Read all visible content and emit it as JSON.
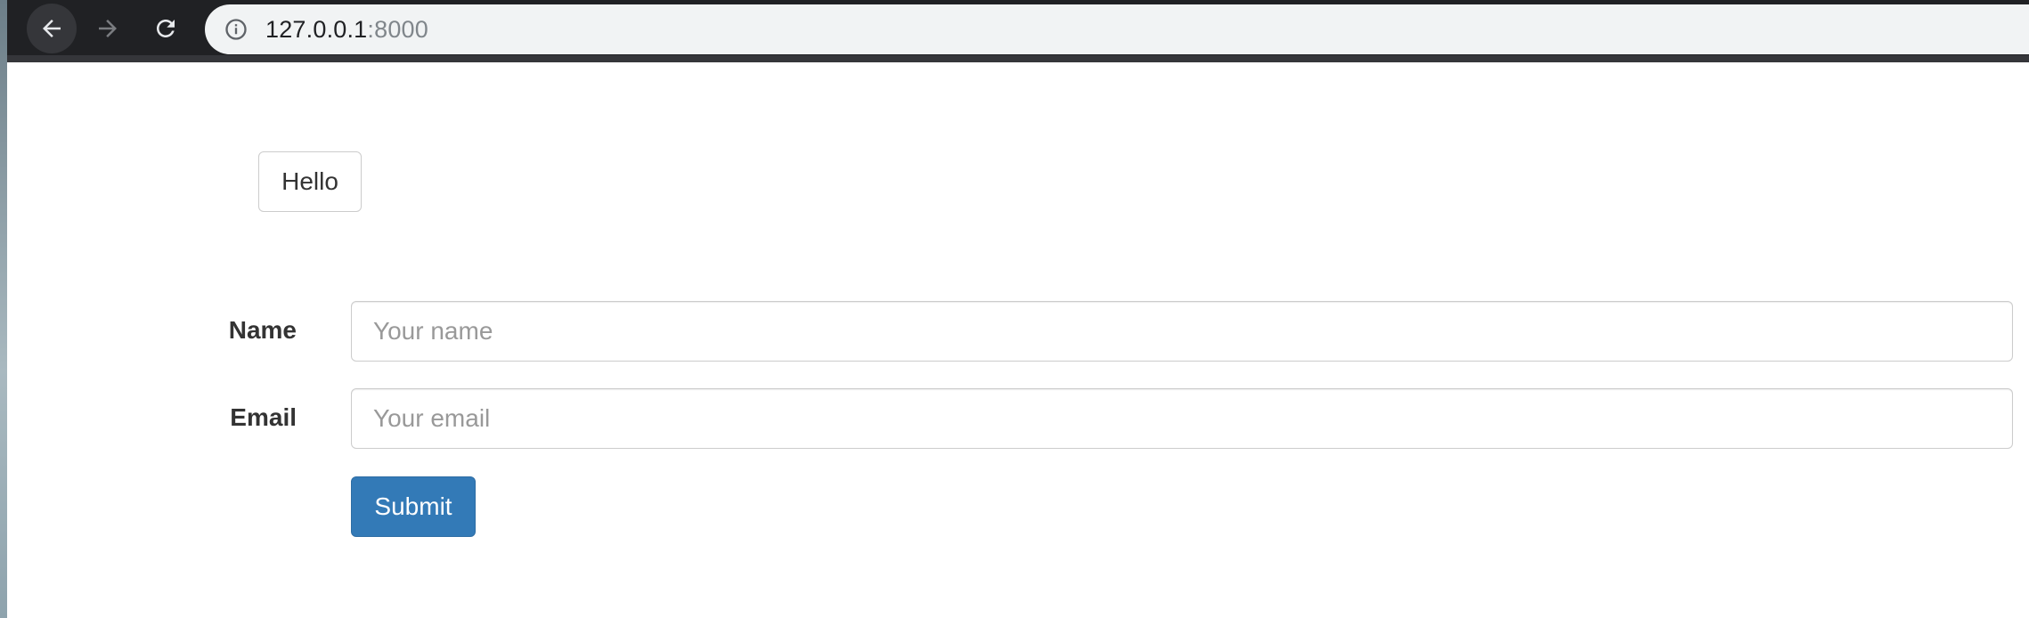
{
  "browser": {
    "url_host": "127.0.0.1",
    "url_port": ":8000",
    "icons": {
      "back": "arrow-left-icon",
      "forward": "arrow-right-icon",
      "reload": "reload-icon",
      "site_info": "info-icon"
    }
  },
  "page": {
    "hello_button_label": "Hello",
    "form": {
      "name_label": "Name",
      "name_placeholder": "Your name",
      "email_label": "Email",
      "email_placeholder": "Your email",
      "submit_label": "Submit"
    }
  },
  "colors": {
    "toolbar_bg": "#202124",
    "omnibox_bg": "#f1f3f4",
    "primary_button": "#337ab7"
  }
}
